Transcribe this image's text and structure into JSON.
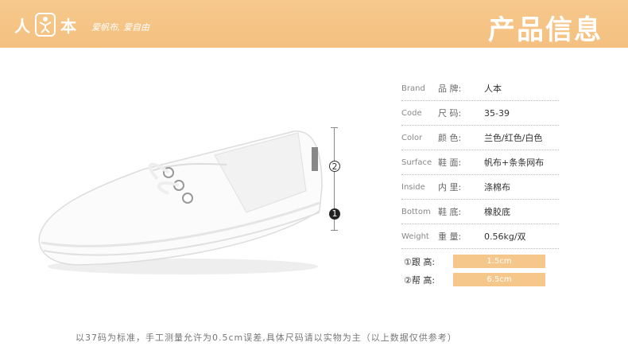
{
  "header": {
    "logo_left": "人",
    "logo_right": "本",
    "slogan": "爱帆布, 爱自由",
    "title": "产品信息"
  },
  "markers": {
    "one": "1",
    "two": "2"
  },
  "specs": [
    {
      "en": "Brand",
      "cn": "品  牌:",
      "value": "人本"
    },
    {
      "en": "Code",
      "cn": "尺  码:",
      "value": "35-39"
    },
    {
      "en": "Color",
      "cn": "颜  色:",
      "value": "兰色/红色/白色"
    },
    {
      "en": "Surface",
      "cn": "鞋  面:",
      "value": "帆布+条条网布"
    },
    {
      "en": "Inside",
      "cn": "内  里:",
      "value": "涤棉布"
    },
    {
      "en": "Bottom",
      "cn": "鞋  底:",
      "value": "橡胶底"
    },
    {
      "en": "Weight",
      "cn": "重  量:",
      "value": "0.56kg/双"
    }
  ],
  "dimensions": [
    {
      "label": "①跟  高:",
      "value": "1.5cm"
    },
    {
      "label": "②帮  高:",
      "value": "6.5cm"
    }
  ],
  "note": "以37码为标准，手工测量允许为0.5cm误差,具体尺码请以实物为主（以上数据仅供参考）",
  "colors": {
    "header": "#f6c98c",
    "bar": "#f6c78a"
  }
}
